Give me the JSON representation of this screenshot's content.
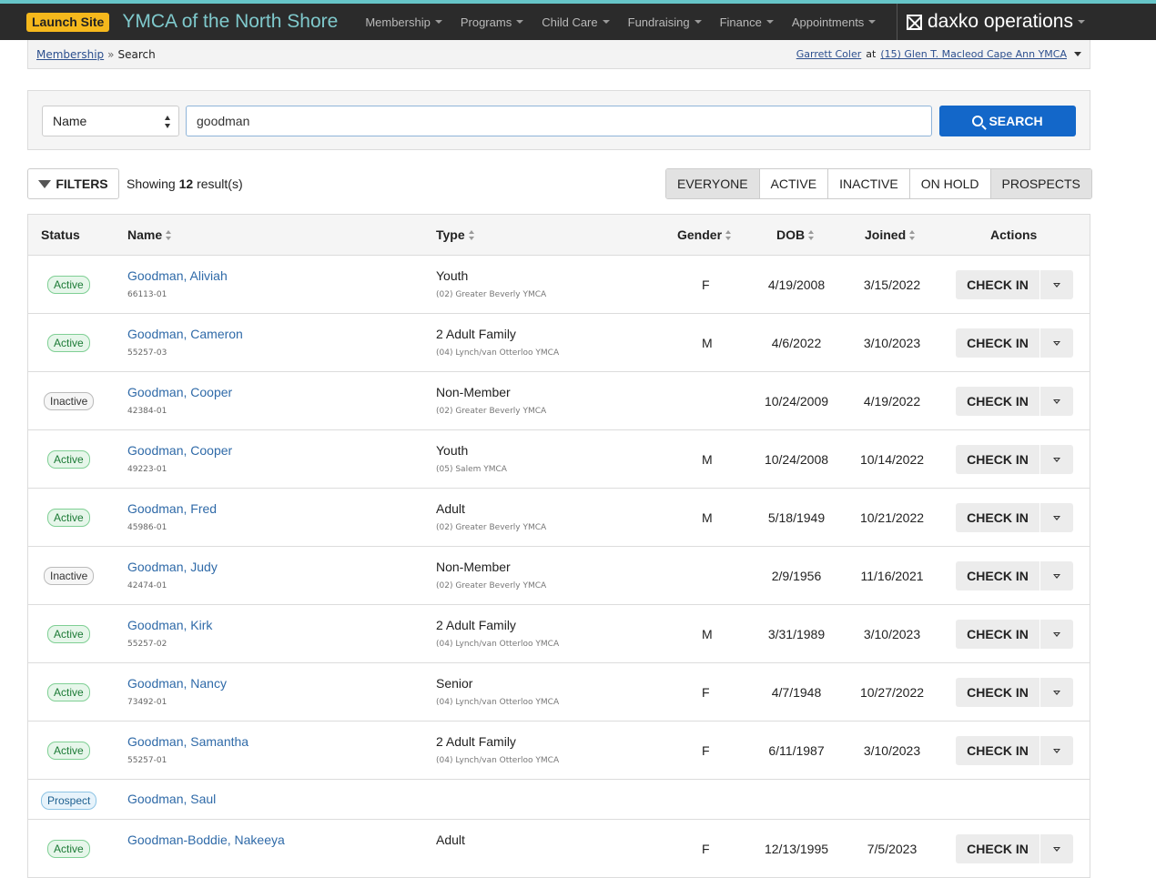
{
  "topbar": {
    "launch_label": "Launch Site",
    "org_title": "YMCA of the North Shore",
    "nav": [
      "Membership",
      "Programs",
      "Child Care",
      "Fundraising",
      "Finance",
      "Appointments"
    ],
    "brand": "daxko operations"
  },
  "breadcrumb": {
    "parent": "Membership",
    "separator": "»",
    "current": "Search",
    "user": "Garrett Coler",
    "at": "at",
    "location": "(15) Glen T. Macleod Cape Ann YMCA"
  },
  "search": {
    "field_select": "Name",
    "query": "goodman",
    "button_label": "SEARCH"
  },
  "results_bar": {
    "filters_label": "FILTERS",
    "showing_prefix": "Showing",
    "count": "12",
    "showing_suffix": "result(s)",
    "segments": [
      "EVERYONE",
      "ACTIVE",
      "INACTIVE",
      "ON HOLD",
      "PROSPECTS"
    ]
  },
  "table": {
    "headers": {
      "status": "Status",
      "name": "Name",
      "type": "Type",
      "gender": "Gender",
      "dob": "DOB",
      "joined": "Joined",
      "actions": "Actions"
    },
    "action_label": "CHECK IN",
    "rows": [
      {
        "status": "Active",
        "name": "Goodman, Aliviah",
        "id": "66113-01",
        "type": "Youth",
        "branch": "(02) Greater Beverly YMCA",
        "gender": "F",
        "dob": "4/19/2008",
        "joined": "3/15/2022"
      },
      {
        "status": "Active",
        "name": "Goodman, Cameron",
        "id": "55257-03",
        "type": "2 Adult Family",
        "branch": "(04) Lynch/van Otterloo YMCA",
        "gender": "M",
        "dob": "4/6/2022",
        "joined": "3/10/2023"
      },
      {
        "status": "Inactive",
        "name": "Goodman, Cooper",
        "id": "42384-01",
        "type": "Non-Member",
        "branch": "(02) Greater Beverly YMCA",
        "gender": "",
        "dob": "10/24/2009",
        "joined": "4/19/2022"
      },
      {
        "status": "Active",
        "name": "Goodman, Cooper",
        "id": "49223-01",
        "type": "Youth",
        "branch": "(05) Salem YMCA",
        "gender": "M",
        "dob": "10/24/2008",
        "joined": "10/14/2022"
      },
      {
        "status": "Active",
        "name": "Goodman, Fred",
        "id": "45986-01",
        "type": "Adult",
        "branch": "(02) Greater Beverly YMCA",
        "gender": "M",
        "dob": "5/18/1949",
        "joined": "10/21/2022"
      },
      {
        "status": "Inactive",
        "name": "Goodman, Judy",
        "id": "42474-01",
        "type": "Non-Member",
        "branch": "(02) Greater Beverly YMCA",
        "gender": "",
        "dob": "2/9/1956",
        "joined": "11/16/2021"
      },
      {
        "status": "Active",
        "name": "Goodman, Kirk",
        "id": "55257-02",
        "type": "2 Adult Family",
        "branch": "(04) Lynch/van Otterloo YMCA",
        "gender": "M",
        "dob": "3/31/1989",
        "joined": "3/10/2023"
      },
      {
        "status": "Active",
        "name": "Goodman, Nancy",
        "id": "73492-01",
        "type": "Senior",
        "branch": "(04) Lynch/van Otterloo YMCA",
        "gender": "F",
        "dob": "4/7/1948",
        "joined": "10/27/2022"
      },
      {
        "status": "Active",
        "name": "Goodman, Samantha",
        "id": "55257-01",
        "type": "2 Adult Family",
        "branch": "(04) Lynch/van Otterloo YMCA",
        "gender": "F",
        "dob": "6/11/1987",
        "joined": "3/10/2023"
      }
    ],
    "prospect_row": {
      "status": "Prospect",
      "name": "Goodman, Saul"
    },
    "last_row": {
      "status": "Active",
      "name": "Goodman-Boddie, Nakeeya",
      "type": "Adult",
      "gender": "F",
      "dob": "12/13/1995",
      "joined": "7/5/2023"
    }
  }
}
